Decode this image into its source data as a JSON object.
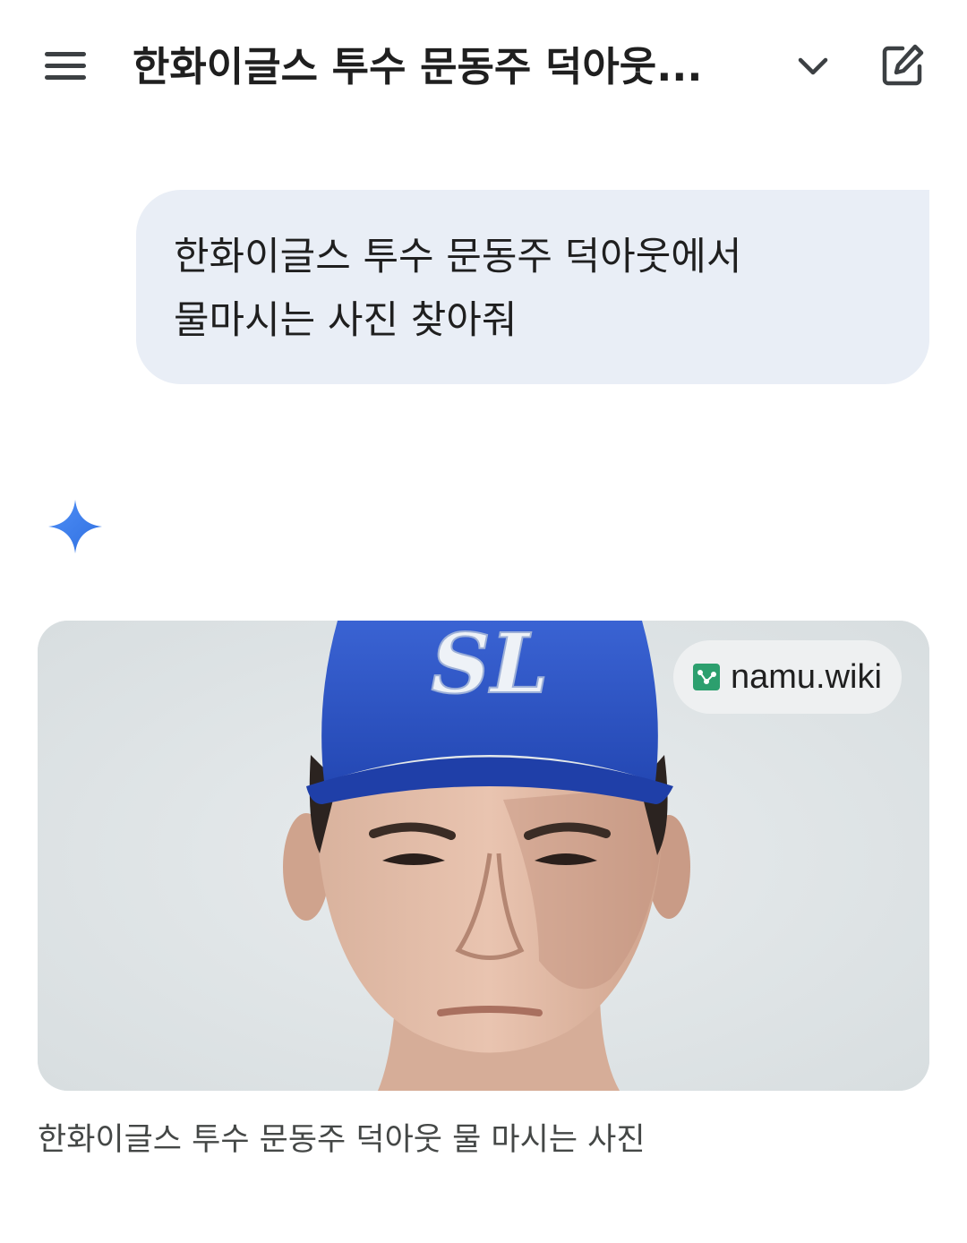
{
  "header": {
    "title": "한화이글스 투수 문동주 덕아웃...",
    "menu_icon": "hamburger-menu-icon",
    "chevron_icon": "chevron-down-icon",
    "edit_icon": "edit-icon"
  },
  "conversation": {
    "user_message": "한화이글스 투수 문동주 덕아웃에서 물마시는 사진 찾아줘",
    "assistant_icon": "gemini-spark-icon"
  },
  "result": {
    "image_alt": "baseball player in blue cap",
    "cap_logo_text": "SL",
    "source": {
      "icon": "namu-wiki-favicon",
      "label": "namu.wiki"
    },
    "caption": "한화이글스 투수 문동주 덕아웃 물 마시는 사진"
  },
  "colors": {
    "bubble_bg": "#e9eef6",
    "cap_blue": "#2f57c9",
    "spark_blue": "#3b79f0",
    "text": "#1f1f1f",
    "caption_text": "#444746"
  }
}
